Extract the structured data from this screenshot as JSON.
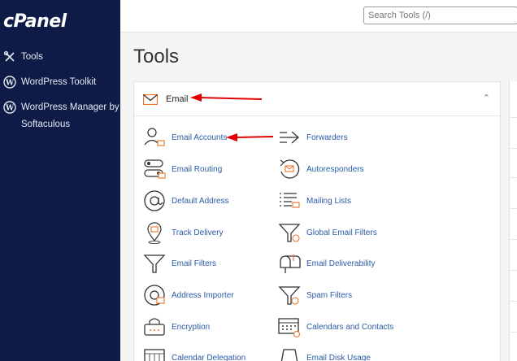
{
  "sidebar": {
    "logo": "cPanel",
    "items": [
      {
        "label": "Tools",
        "icon": "tools-icon"
      },
      {
        "label": "WordPress Toolkit",
        "icon": "wordpress-icon"
      },
      {
        "label": "WordPress Manager by Softaculous",
        "icon": "wordpress-icon"
      }
    ]
  },
  "header": {
    "search_placeholder": "Search Tools (/)"
  },
  "page": {
    "title": "Tools"
  },
  "panel": {
    "title": "Email",
    "tools_left": [
      {
        "label": "Email Accounts",
        "icon": "email-accounts-icon"
      },
      {
        "label": "Email Routing",
        "icon": "email-routing-icon"
      },
      {
        "label": "Default Address",
        "icon": "at-sign-icon"
      },
      {
        "label": "Track Delivery",
        "icon": "track-delivery-icon"
      },
      {
        "label": "Email Filters",
        "icon": "filter-icon"
      },
      {
        "label": "Address Importer",
        "icon": "address-importer-icon"
      },
      {
        "label": "Encryption",
        "icon": "encryption-icon"
      },
      {
        "label": "Calendar Delegation",
        "icon": "calendar-delegation-icon"
      }
    ],
    "tools_right": [
      {
        "label": "Forwarders",
        "icon": "forwarders-icon"
      },
      {
        "label": "Autoresponders",
        "icon": "autoresponders-icon"
      },
      {
        "label": "Mailing Lists",
        "icon": "mailing-lists-icon"
      },
      {
        "label": "Global Email Filters",
        "icon": "global-filter-icon"
      },
      {
        "label": "Email Deliverability",
        "icon": "mailbox-icon"
      },
      {
        "label": "Spam Filters",
        "icon": "spam-filter-icon"
      },
      {
        "label": "Calendars and Contacts",
        "icon": "calendar-icon"
      },
      {
        "label": "Email Disk Usage",
        "icon": "disk-usage-icon"
      }
    ]
  },
  "colors": {
    "sidebar_bg": "#0d1b46",
    "link": "#2a5ba6",
    "accent_orange": "#e8742a",
    "annotation_red": "#e00000"
  }
}
